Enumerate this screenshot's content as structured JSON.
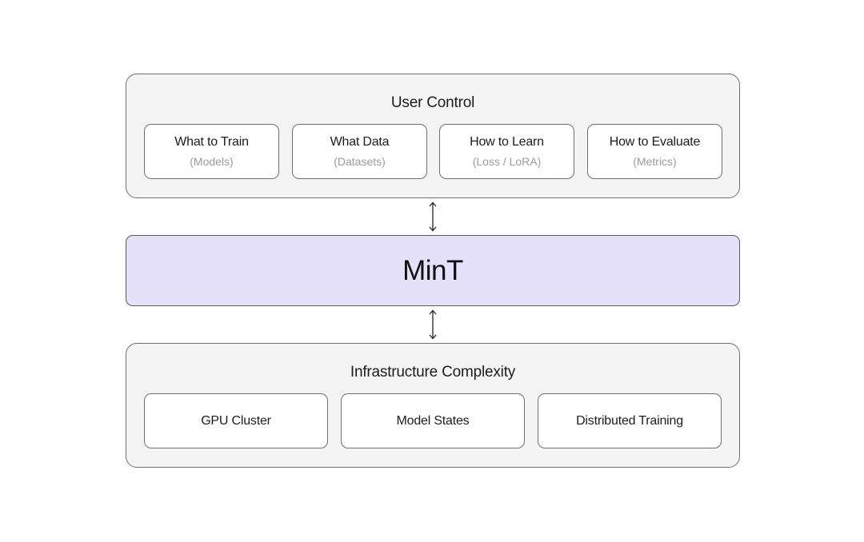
{
  "user_control": {
    "title": "User Control",
    "cards": [
      {
        "title": "What to Train",
        "subtitle": "(Models)"
      },
      {
        "title": "What Data",
        "subtitle": "(Datasets)"
      },
      {
        "title": "How to Learn",
        "subtitle": "(Loss / LoRA)"
      },
      {
        "title": "How to Evaluate",
        "subtitle": "(Metrics)"
      }
    ]
  },
  "mint": {
    "title": "MinT",
    "fill_color": "#e6e1fb"
  },
  "infrastructure": {
    "title": "Infrastructure Complexity",
    "cards": [
      {
        "title": "GPU Cluster"
      },
      {
        "title": "Model States"
      },
      {
        "title": "Distributed Training"
      }
    ]
  },
  "connectors": [
    "double-arrow-icon",
    "double-arrow-icon"
  ]
}
